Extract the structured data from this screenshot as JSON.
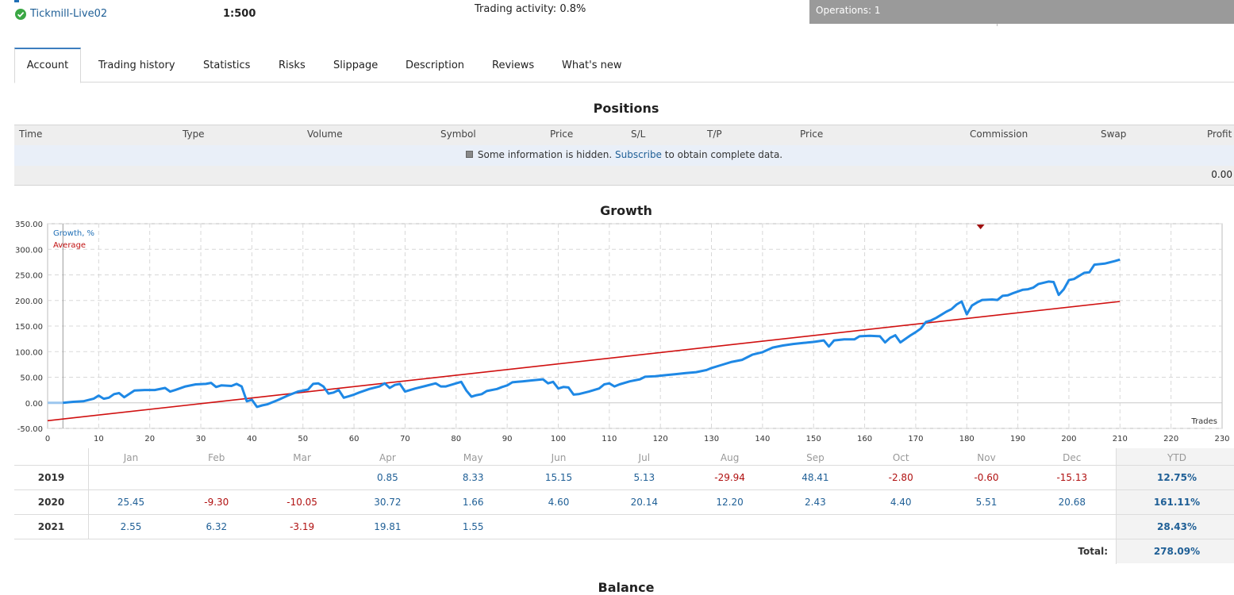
{
  "header": {
    "account_name": "Tickmill-Live02",
    "leverage": "1:500",
    "trading_activity": "Trading activity: 0.8%",
    "operations": "Operations: 1"
  },
  "tabs": [
    {
      "label": "Account",
      "active": true
    },
    {
      "label": "Trading history"
    },
    {
      "label": "Statistics"
    },
    {
      "label": "Risks"
    },
    {
      "label": "Slippage"
    },
    {
      "label": "Description"
    },
    {
      "label": "Reviews"
    },
    {
      "label": "What's new"
    }
  ],
  "positions": {
    "title": "Positions",
    "columns": [
      "Time",
      "Type",
      "Volume",
      "Symbol",
      "Price",
      "S/L",
      "T/P",
      "Price",
      "Commission",
      "Swap",
      "Profit"
    ],
    "info_prefix": "Some information is hidden.",
    "info_link": "Subscribe",
    "info_suffix": "to obtain complete data.",
    "total": "0.00"
  },
  "growth": {
    "title": "Growth",
    "legend": [
      "Growth, %",
      "Average"
    ],
    "x_axis_label": "Trades"
  },
  "colors": {
    "growth_line": "#1e88e5",
    "average_line": "#d01010",
    "positive": "#1f5f96",
    "negative": "#b01010"
  },
  "chart_data": {
    "type": "line",
    "xlim": [
      0,
      230
    ],
    "ylim": [
      -50,
      350
    ],
    "x_ticks": [
      "0",
      "10",
      "20",
      "30",
      "40",
      "50",
      "60",
      "70",
      "80",
      "90",
      "100",
      "110",
      "120",
      "130",
      "140",
      "150",
      "160",
      "170",
      "180",
      "190",
      "200",
      "210",
      "220",
      "230"
    ],
    "y_ticks": [
      "350.00",
      "300.00",
      "250.00",
      "200.00",
      "150.00",
      "100.00",
      "50.00",
      "0.00",
      "-50.00"
    ],
    "xlabel": "Trades",
    "legend_position": "top-left",
    "grid": true,
    "series": [
      {
        "name": "Growth, %",
        "points": [
          [
            0,
            0
          ],
          [
            3,
            0
          ],
          [
            5,
            2
          ],
          [
            7,
            3
          ],
          [
            9,
            8
          ],
          [
            10,
            14
          ],
          [
            11,
            8
          ],
          [
            12,
            10
          ],
          [
            13,
            17
          ],
          [
            14,
            19
          ],
          [
            15,
            11
          ],
          [
            17,
            24
          ],
          [
            19,
            25
          ],
          [
            21,
            25
          ],
          [
            23,
            29
          ],
          [
            24,
            22
          ],
          [
            25,
            25
          ],
          [
            27,
            32
          ],
          [
            29,
            36
          ],
          [
            31,
            37
          ],
          [
            32,
            39
          ],
          [
            33,
            31
          ],
          [
            34,
            34
          ],
          [
            36,
            33
          ],
          [
            37,
            37
          ],
          [
            38,
            32
          ],
          [
            39,
            3
          ],
          [
            40,
            6
          ],
          [
            41,
            -8
          ],
          [
            42,
            -5
          ],
          [
            43,
            -3
          ],
          [
            45,
            5
          ],
          [
            47,
            14
          ],
          [
            49,
            22
          ],
          [
            51,
            26
          ],
          [
            52,
            37
          ],
          [
            53,
            38
          ],
          [
            54,
            32
          ],
          [
            55,
            18
          ],
          [
            56,
            20
          ],
          [
            57,
            25
          ],
          [
            58,
            10
          ],
          [
            59,
            13
          ],
          [
            60,
            16
          ],
          [
            61,
            20
          ],
          [
            63,
            27
          ],
          [
            65,
            32
          ],
          [
            66,
            38
          ],
          [
            67,
            29
          ],
          [
            68,
            35
          ],
          [
            69,
            37
          ],
          [
            70,
            22
          ],
          [
            72,
            28
          ],
          [
            74,
            33
          ],
          [
            76,
            38
          ],
          [
            77,
            32
          ],
          [
            78,
            32
          ],
          [
            80,
            38
          ],
          [
            81,
            41
          ],
          [
            82,
            24
          ],
          [
            83,
            12
          ],
          [
            84,
            15
          ],
          [
            85,
            17
          ],
          [
            86,
            23
          ],
          [
            88,
            27
          ],
          [
            89,
            31
          ],
          [
            90,
            34
          ],
          [
            91,
            40
          ],
          [
            92,
            41
          ],
          [
            93,
            42
          ],
          [
            95,
            44
          ],
          [
            97,
            46
          ],
          [
            98,
            38
          ],
          [
            99,
            41
          ],
          [
            100,
            28
          ],
          [
            101,
            31
          ],
          [
            102,
            30
          ],
          [
            103,
            16
          ],
          [
            104,
            17
          ],
          [
            106,
            22
          ],
          [
            108,
            28
          ],
          [
            109,
            36
          ],
          [
            110,
            38
          ],
          [
            111,
            32
          ],
          [
            112,
            36
          ],
          [
            114,
            42
          ],
          [
            116,
            46
          ],
          [
            117,
            51
          ],
          [
            119,
            52
          ],
          [
            121,
            54
          ],
          [
            123,
            56
          ],
          [
            125,
            58
          ],
          [
            127,
            60
          ],
          [
            129,
            64
          ],
          [
            130,
            68
          ],
          [
            132,
            74
          ],
          [
            134,
            80
          ],
          [
            136,
            84
          ],
          [
            138,
            94
          ],
          [
            140,
            99
          ],
          [
            142,
            108
          ],
          [
            144,
            112
          ],
          [
            146,
            115
          ],
          [
            148,
            117
          ],
          [
            150,
            119
          ],
          [
            152,
            122
          ],
          [
            153,
            110
          ],
          [
            154,
            122
          ],
          [
            156,
            124
          ],
          [
            158,
            124
          ],
          [
            159,
            130
          ],
          [
            161,
            131
          ],
          [
            163,
            130
          ],
          [
            164,
            118
          ],
          [
            165,
            127
          ],
          [
            166,
            132
          ],
          [
            167,
            118
          ],
          [
            168,
            125
          ],
          [
            169,
            132
          ],
          [
            170,
            138
          ],
          [
            171,
            145
          ],
          [
            172,
            158
          ],
          [
            173,
            161
          ],
          [
            174,
            166
          ],
          [
            175,
            172
          ],
          [
            176,
            178
          ],
          [
            177,
            183
          ],
          [
            178,
            192
          ],
          [
            179,
            198
          ],
          [
            180,
            173
          ],
          [
            181,
            190
          ],
          [
            182,
            196
          ],
          [
            183,
            201
          ],
          [
            185,
            202
          ],
          [
            186,
            201
          ],
          [
            187,
            209
          ],
          [
            188,
            210
          ],
          [
            189,
            214
          ],
          [
            191,
            221
          ],
          [
            192,
            222
          ],
          [
            193,
            225
          ],
          [
            194,
            232
          ],
          [
            196,
            237
          ],
          [
            197,
            236
          ],
          [
            198,
            211
          ],
          [
            199,
            222
          ],
          [
            200,
            240
          ],
          [
            201,
            242
          ],
          [
            202,
            248
          ],
          [
            203,
            254
          ],
          [
            204,
            255
          ],
          [
            205,
            270
          ],
          [
            207,
            272
          ],
          [
            209,
            277
          ],
          [
            210,
            280
          ]
        ]
      },
      {
        "name": "Average",
        "points": [
          [
            0,
            -35
          ],
          [
            210,
            198
          ]
        ]
      }
    ]
  },
  "monthly": {
    "months": [
      "Jan",
      "Feb",
      "Mar",
      "Apr",
      "May",
      "Jun",
      "Jul",
      "Aug",
      "Sep",
      "Oct",
      "Nov",
      "Dec"
    ],
    "ytd_header": "YTD",
    "rows": [
      {
        "year": "2019",
        "values": [
          "",
          "",
          "",
          "0.85",
          "8.33",
          "15.15",
          "5.13",
          "-29.94",
          "48.41",
          "-2.80",
          "-0.60",
          "-15.13"
        ],
        "ytd": "12.75%"
      },
      {
        "year": "2020",
        "values": [
          "25.45",
          "-9.30",
          "-10.05",
          "30.72",
          "1.66",
          "4.60",
          "20.14",
          "12.20",
          "2.43",
          "4.40",
          "5.51",
          "20.68"
        ],
        "ytd": "161.11%"
      },
      {
        "year": "2021",
        "values": [
          "2.55",
          "6.32",
          "-3.19",
          "19.81",
          "1.55",
          "",
          "",
          "",
          "",
          "",
          "",
          ""
        ],
        "ytd": "28.43%"
      }
    ],
    "total_label": "Total:",
    "total_value": "278.09%"
  },
  "balance": {
    "title": "Balance"
  }
}
